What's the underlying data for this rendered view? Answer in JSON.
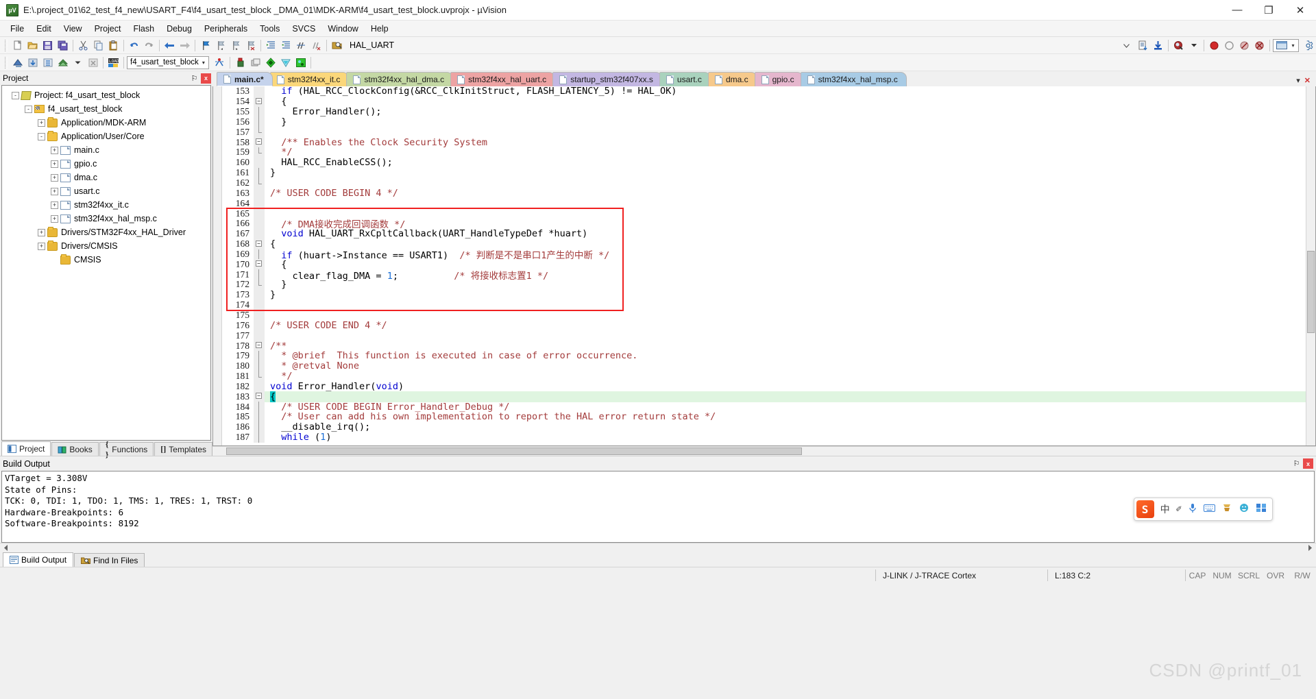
{
  "window": {
    "title": "E:\\.project_01\\62_test_f4_new\\USART_F4\\f4_usart_test_block _DMA_01\\MDK-ARM\\f4_usart_test_block.uvprojx - µVision",
    "app_badge": "µV",
    "minimize": "—",
    "maximize": "❐",
    "close": "✕"
  },
  "menu": [
    "File",
    "Edit",
    "View",
    "Project",
    "Flash",
    "Debug",
    "Peripherals",
    "Tools",
    "SVCS",
    "Window",
    "Help"
  ],
  "toolbar1": {
    "target_combo": "HAL_UART",
    "icons": [
      "new-file-icon",
      "open-file-icon",
      "save-icon",
      "save-all-icon",
      "cut-icon",
      "copy-icon",
      "paste-icon",
      "undo-icon",
      "redo-icon",
      "navigate-back-icon",
      "navigate-forward-icon",
      "bookmark-toggle-icon",
      "bookmark-prev-icon",
      "bookmark-next-icon",
      "bookmark-clear-icon",
      "indent-icon",
      "outdent-icon",
      "comment-icon",
      "uncomment-icon",
      "find-in-files-icon"
    ]
  },
  "toolbar2": {
    "project_combo": "f4_usart_test_block",
    "icons": [
      "translate-icon",
      "build-icon",
      "rebuild-icon",
      "batch-build-icon",
      "stop-build-icon",
      "download-icon",
      "target-options-icon",
      "manage-runtime-icon",
      "configure-icon",
      "components-icon",
      "pack-installer-icon",
      "manage-project-icon"
    ]
  },
  "project_pane": {
    "header": "Project",
    "pin_glyph": "⚐",
    "close_glyph": "x",
    "tree": [
      {
        "label": "Project: f4_usart_test_block",
        "indent": 0,
        "expander": "-",
        "icon": "project-icon"
      },
      {
        "label": "f4_usart_test_block",
        "indent": 1,
        "expander": "-",
        "icon": "target-icon"
      },
      {
        "label": "Application/MDK-ARM",
        "indent": 2,
        "expander": "+",
        "icon": "folder-icon"
      },
      {
        "label": "Application/User/Core",
        "indent": 2,
        "expander": "-",
        "icon": "folder-open-icon"
      },
      {
        "label": "main.c",
        "indent": 3,
        "expander": "+",
        "icon": "c-file-icon"
      },
      {
        "label": "gpio.c",
        "indent": 3,
        "expander": "+",
        "icon": "c-file-icon"
      },
      {
        "label": "dma.c",
        "indent": 3,
        "expander": "+",
        "icon": "c-file-icon"
      },
      {
        "label": "usart.c",
        "indent": 3,
        "expander": "+",
        "icon": "c-file-icon"
      },
      {
        "label": "stm32f4xx_it.c",
        "indent": 3,
        "expander": "+",
        "icon": "c-file-icon"
      },
      {
        "label": "stm32f4xx_hal_msp.c",
        "indent": 3,
        "expander": "+",
        "icon": "c-file-icon"
      },
      {
        "label": "Drivers/STM32F4xx_HAL_Driver",
        "indent": 2,
        "expander": "+",
        "icon": "folder-icon"
      },
      {
        "label": "Drivers/CMSIS",
        "indent": 2,
        "expander": "+",
        "icon": "folder-icon"
      },
      {
        "label": "CMSIS",
        "indent": 3,
        "expander": "",
        "icon": "folder-icon"
      }
    ],
    "tabs": [
      {
        "label": "Project",
        "active": true,
        "icon": "project-tab-icon"
      },
      {
        "label": "Books",
        "active": false,
        "icon": "books-icon"
      },
      {
        "label": "Functions",
        "active": false,
        "icon": "functions-icon"
      },
      {
        "label": "Templates",
        "active": false,
        "icon": "templates-icon"
      }
    ]
  },
  "editor": {
    "tabs": [
      {
        "label": "main.c*",
        "color": "#c5d3ec",
        "active": true
      },
      {
        "label": "stm32f4xx_it.c",
        "color": "#fbd77a",
        "active": false
      },
      {
        "label": "stm32f4xx_hal_dma.c",
        "color": "#c4d8a4",
        "active": false
      },
      {
        "label": "stm32f4xx_hal_uart.c",
        "color": "#eda3a3",
        "active": false
      },
      {
        "label": "startup_stm32f407xx.s",
        "color": "#c3b7e2",
        "active": false
      },
      {
        "label": "usart.c",
        "color": "#a9d2bd",
        "active": false
      },
      {
        "label": "dma.c",
        "color": "#f6c98b",
        "active": false
      },
      {
        "label": "gpio.c",
        "color": "#e5b6cd",
        "active": false
      },
      {
        "label": "stm32f4xx_hal_msp.c",
        "color": "#a8cbe5",
        "active": false
      }
    ],
    "scroll_left_glyph": "▾",
    "scroll_close_glyph": "✕",
    "lines": [
      {
        "n": 153,
        "fold": "",
        "html": "  <span class='kw'>if</span> (HAL_RCC_ClockConfig(&amp;RCC_ClkInitStruct, FLASH_LATENCY_5) != HAL_OK)"
      },
      {
        "n": 154,
        "fold": "box",
        "html": "  {"
      },
      {
        "n": 155,
        "fold": "line",
        "html": "    Error_Handler();"
      },
      {
        "n": 156,
        "fold": "line",
        "html": "  }"
      },
      {
        "n": 157,
        "fold": "end",
        "html": ""
      },
      {
        "n": 158,
        "fold": "box",
        "html": "  <span class='cm'>/** Enables the Clock Security System</span>"
      },
      {
        "n": 159,
        "fold": "end",
        "html": "  <span class='cm'>*/</span>"
      },
      {
        "n": 160,
        "fold": "",
        "html": "  HAL_RCC_EnableCSS();"
      },
      {
        "n": 161,
        "fold": "line",
        "html": "}"
      },
      {
        "n": 162,
        "fold": "end",
        "html": ""
      },
      {
        "n": 163,
        "fold": "",
        "html": "<span class='cm'>/* USER CODE BEGIN 4 */</span>"
      },
      {
        "n": 164,
        "fold": "",
        "html": ""
      },
      {
        "n": 165,
        "fold": "",
        "html": ""
      },
      {
        "n": 166,
        "fold": "",
        "html": "  <span class='cm'>/* DMA接收完成回调函数 */</span>"
      },
      {
        "n": 167,
        "fold": "",
        "html": "  <span class='kw'>void</span> HAL_UART_RxCpltCallback(UART_HandleTypeDef *huart)"
      },
      {
        "n": 168,
        "fold": "box",
        "html": "{"
      },
      {
        "n": 169,
        "fold": "line",
        "html": "  <span class='kw'>if</span> (huart-&gt;Instance == USART1)  <span class='cm'>/* 判断是不是串口1产生的中断 */</span>"
      },
      {
        "n": 170,
        "fold": "box",
        "html": "  {"
      },
      {
        "n": 171,
        "fold": "line",
        "html": "    clear_flag_DMA = <span class='num'>1</span>;          <span class='cm'>/* 将接收标志置1 */</span>"
      },
      {
        "n": 172,
        "fold": "end",
        "html": "  }"
      },
      {
        "n": 173,
        "fold": "",
        "html": "}"
      },
      {
        "n": 174,
        "fold": "",
        "html": ""
      },
      {
        "n": 175,
        "fold": "",
        "html": ""
      },
      {
        "n": 176,
        "fold": "",
        "html": "<span class='cm'>/* USER CODE END 4 */</span>"
      },
      {
        "n": 177,
        "fold": "",
        "html": ""
      },
      {
        "n": 178,
        "fold": "box",
        "html": "<span class='cm'>/**</span>"
      },
      {
        "n": 179,
        "fold": "line",
        "html": "  <span class='cm'>* @brief  This function is executed in case of error occurrence.</span>"
      },
      {
        "n": 180,
        "fold": "line",
        "html": "  <span class='cm'>* @retval None</span>"
      },
      {
        "n": 181,
        "fold": "end",
        "html": "  <span class='cm'>*/</span>"
      },
      {
        "n": 182,
        "fold": "",
        "html": "<span class='kw'>void</span> Error_Handler(<span class='kw'>void</span>)"
      },
      {
        "n": 183,
        "fold": "box",
        "html": "<span class='caretblk'>{</span>",
        "highlight": true
      },
      {
        "n": 184,
        "fold": "line",
        "html": "  <span class='cm'>/* USER CODE BEGIN Error_Handler_Debug */</span>"
      },
      {
        "n": 185,
        "fold": "line",
        "html": "  <span class='cm'>/* User can add his own implementation to report the HAL error return state */</span>"
      },
      {
        "n": 186,
        "fold": "line",
        "html": "  __disable_irq();"
      },
      {
        "n": 187,
        "fold": "line",
        "html": "  <span class='kw'>while</span> (<span class='num'>1</span>)"
      }
    ],
    "highlight_box_color": "#f02020"
  },
  "build_output": {
    "header": "Build Output",
    "pin_glyph": "⚐",
    "close_glyph": "x",
    "lines": [
      "VTarget = 3.308V",
      "State of Pins:",
      "TCK: 0, TDI: 1, TDO: 1, TMS: 1, TRES: 1, TRST: 0",
      "Hardware-Breakpoints: 6",
      "Software-Breakpoints: 8192"
    ],
    "tabs": [
      {
        "label": "Build Output",
        "active": true,
        "icon": "build-output-icon"
      },
      {
        "label": "Find In Files",
        "active": false,
        "icon": "find-in-files-icon"
      }
    ]
  },
  "ime_bar": {
    "logo": "S",
    "mode": "中",
    "items": [
      "voice-input-icon",
      "keyboard-icon",
      "skin-icon",
      "emoji-icon",
      "toolbox-icon"
    ],
    "pen_glyph": "✐"
  },
  "statusbar": {
    "debugger": "J-LINK / J-TRACE Cortex",
    "cursor": "L:183 C:2",
    "indicators": [
      "CAP",
      "NUM",
      "SCRL",
      "OVR",
      "R/W"
    ]
  },
  "watermark": "CSDN @printf_01",
  "colors": {
    "accent": "#f02020",
    "keyword": "#0000d0",
    "comment": "#a33b3b",
    "number": "#1b6fd6",
    "current_line": "#dff5e0",
    "caret_block": "#00c8c8"
  }
}
